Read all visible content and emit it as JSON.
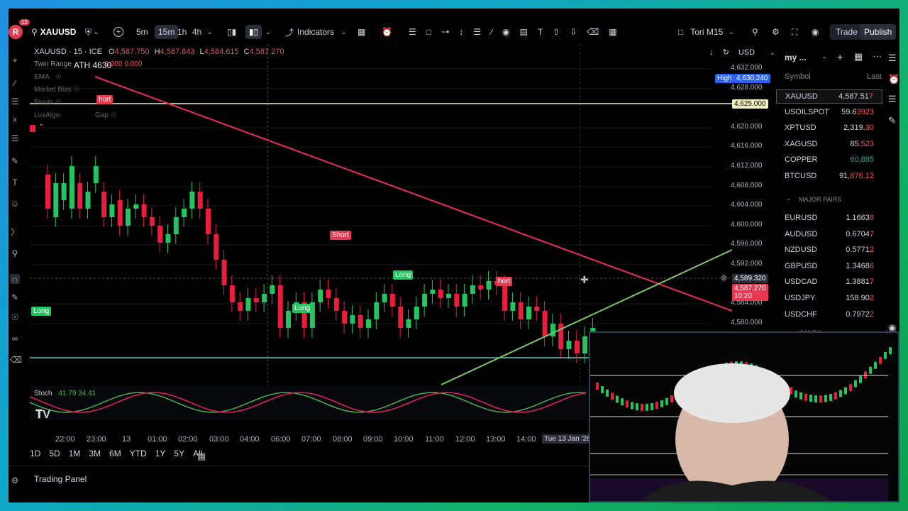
{
  "toolbar": {
    "avatar_letter": "R",
    "notif_count": "12",
    "symbol": "XAUUSD",
    "intervals": [
      "5m",
      "15m",
      "1h",
      "4h"
    ],
    "active_interval": "15m",
    "indicators_label": "Indicators",
    "layout_name": "Tori M15",
    "trade_label": "Trade",
    "publish_label": "Publish"
  },
  "legend": {
    "title": "XAUUSD · 15 · ICE",
    "o_label": "O",
    "o": "4,587.750",
    "h_label": "H",
    "h": "4,587.843",
    "l_label": "L",
    "l": "4,584.615",
    "c_label": "C",
    "c": "4,587.270",
    "ath_text": "ATH 4630",
    "twin_range": "Twin Range",
    "twin_values": "0.000  0.000",
    "indicators": [
      "EMA",
      "Market Bias",
      "Pivots",
      "LuxAlgo",
      "Gap"
    ]
  },
  "price_axis": {
    "currency": "USD",
    "ticks": [
      "4,632.000",
      "4,628.000",
      "4,620.000",
      "4,616.000",
      "4,612.000",
      "4,608.000",
      "4,604.000",
      "4,600.000",
      "4,596.000",
      "4,592.000",
      "4,584.000",
      "4,580.000"
    ],
    "high_label": "High",
    "high_value": "4,630.240",
    "level_value": "4,625.000",
    "crosshair_value": "4,589.320",
    "last_price": "4,587.270",
    "countdown": "10:20"
  },
  "signals": {
    "short_a": "hort",
    "short_b": "Short",
    "short_c": "hort",
    "long_a": "Long",
    "long_b": "Long",
    "long_c": "Long"
  },
  "stoch": {
    "label": "Stoch",
    "values": "41.79  34.41"
  },
  "time_axis": {
    "ticks": [
      "22:00",
      "23:00",
      "13",
      "01:00",
      "02:00",
      "03:00",
      "04:00",
      "06:00",
      "07:00",
      "08:00",
      "09:00",
      "10:00",
      "11:00",
      "12:00",
      "13:00",
      "14:00"
    ],
    "cursor_date": "Tue 13 Jan '26"
  },
  "ranges": [
    "1D",
    "5D",
    "1M",
    "3M",
    "6M",
    "YTD",
    "1Y",
    "5Y",
    "All"
  ],
  "trading_panel": "Trading Panel",
  "watchlist": {
    "title": "my ...",
    "col_symbol": "Symbol",
    "col_last": "Last",
    "rows": [
      {
        "s": "XAUUSD",
        "v": "4,587.51",
        "sup": "7"
      },
      {
        "s": "USOILSPOT",
        "v": "59.6",
        "sup": "3923"
      },
      {
        "s": "XPTUSD",
        "v": "2,319.",
        "sup": "30"
      },
      {
        "s": "XAGUSD",
        "v": "85.",
        "sup": "523"
      },
      {
        "s": "COPPER",
        "v": "60,885",
        "sup": ""
      },
      {
        "s": "BTCUSD",
        "v": "91,",
        "sup": "876.12"
      }
    ],
    "section": "MAJOR PAIRS",
    "pairs": [
      {
        "s": "EURUSD",
        "v": "1.1663",
        "sup": "8"
      },
      {
        "s": "AUDUSD",
        "v": "0.6704",
        "sup": "7"
      },
      {
        "s": "NZDUSD",
        "v": "0.5771",
        "sup": "2"
      },
      {
        "s": "GBPUSD",
        "v": "1.3468",
        "sup": "6"
      },
      {
        "s": "USDCAD",
        "v": "1.3881",
        "sup": "7"
      },
      {
        "s": "USDJPY",
        "v": "158.90",
        "sup": "2"
      },
      {
        "s": "USDCHF",
        "v": "0.7972",
        "sup": "2"
      }
    ],
    "next_section": "OANDA"
  },
  "colors": {
    "up": "#26a69a",
    "down": "#ef5350",
    "bull_bright": "#22c55e",
    "bear_bright": "#e91e3c",
    "accent": "#2962ff"
  }
}
